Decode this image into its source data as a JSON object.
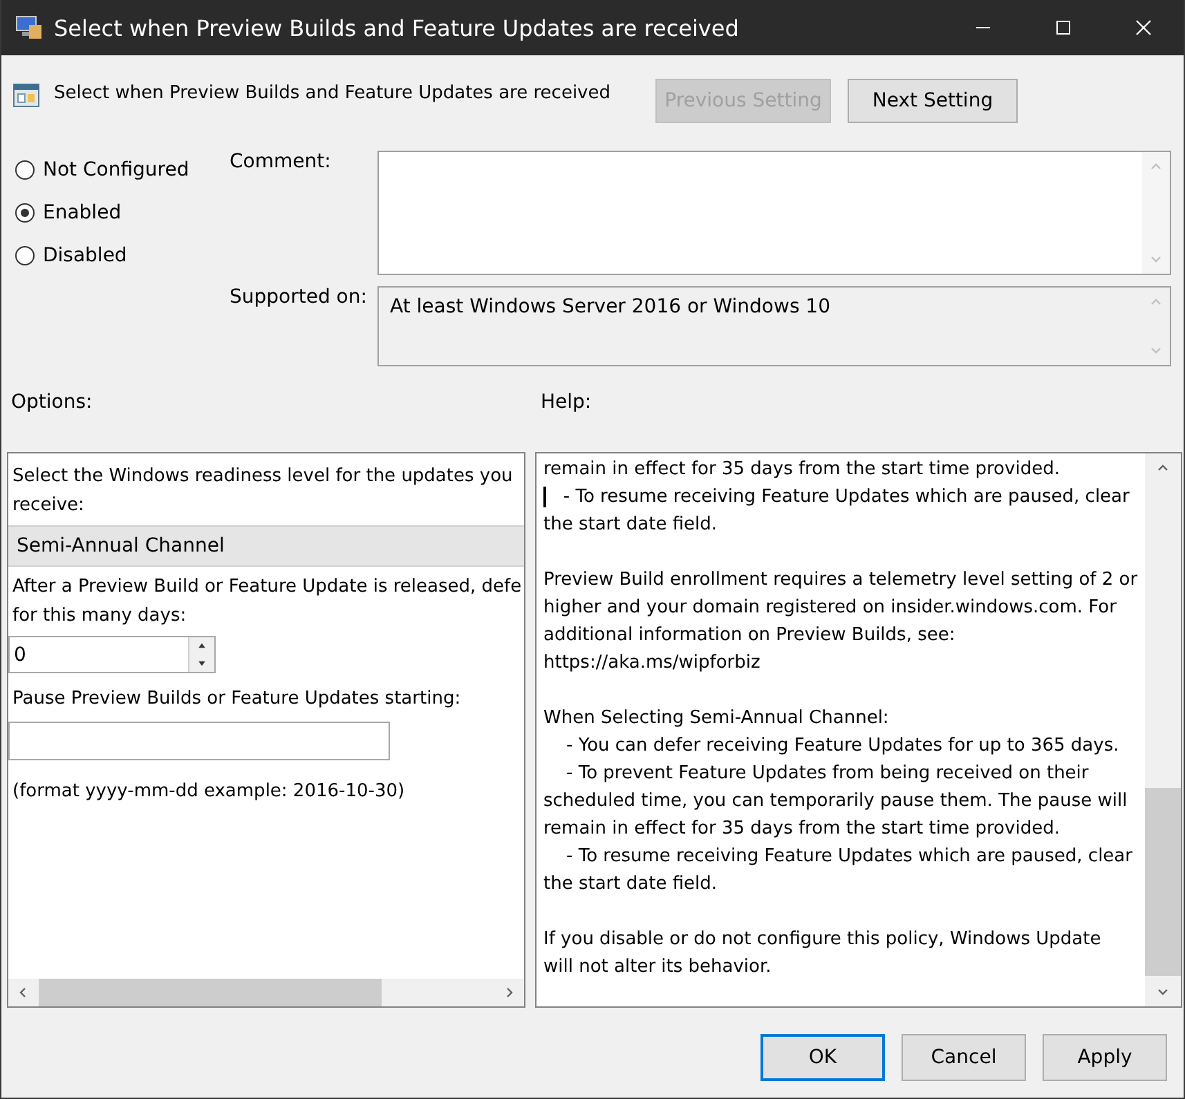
{
  "window": {
    "title": "Select when Preview Builds and Feature Updates are received"
  },
  "header": {
    "title": "Select when Preview Builds and Feature Updates are received"
  },
  "nav_buttons": [
    {
      "label": "Previous Setting",
      "disabled": true
    },
    {
      "label": "Next Setting",
      "disabled": false
    }
  ],
  "radios": [
    {
      "label": "Not Configured",
      "selected": false
    },
    {
      "label": "Enabled",
      "selected": true
    },
    {
      "label": "Disabled",
      "selected": false
    }
  ],
  "comment": {
    "label": "Comment:"
  },
  "supported_on": {
    "label": "Supported on:",
    "value": "At least Windows Server 2016 or Windows 10"
  },
  "options": {
    "label": "Options:",
    "readiness_label": [
      "Select the Windows readiness level for the updates you",
      "receive:"
    ],
    "channel": "Semi-Annual Channel",
    "defer_label": [
      "After a Preview Build or Feature Update is released, defe",
      "for this many days:"
    ],
    "defer_days": "0",
    "pause_label": "Pause Preview Builds or Feature Updates starting:",
    "format_note": "(format yyyy-mm-dd example: 2016-10-30)"
  },
  "help": {
    "label": "Help:",
    "paragraphs": [
      [
        "remain in effect for 35 days from the start time provided.",
        "    - To resume receiving Feature Updates which are paused, clear",
        "the start date field."
      ],
      [
        "Preview Build enrollment requires a telemetry level setting of 2 or",
        "higher and your domain registered on insider.windows.com. For",
        "additional information on Preview Builds, see:",
        "https://aka.ms/wipforbiz"
      ],
      [
        "When Selecting Semi-Annual Channel:",
        "    - You can defer receiving Feature Updates for up to 365 days.",
        "    - To prevent Feature Updates from being received on their",
        "scheduled time, you can temporarily pause them. The pause will",
        "remain in effect for 35 days from the start time provided.",
        "    - To resume receiving Feature Updates which are paused, clear",
        "the start date field."
      ],
      [
        "If you disable or do not configure this policy, Windows Update",
        "will not alter its behavior."
      ]
    ]
  },
  "dialog_buttons": [
    {
      "label": "OK",
      "default": true
    },
    {
      "label": "Cancel",
      "default": false
    },
    {
      "label": "Apply",
      "default": false
    }
  ]
}
